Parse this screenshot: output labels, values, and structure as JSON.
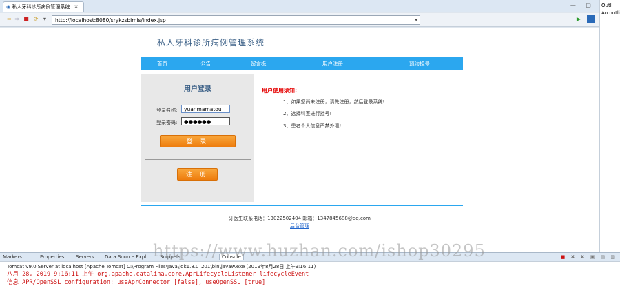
{
  "editor": {
    "tab_title": "私人牙科诊所病例管理系统",
    "tab_close": "✕",
    "window_controls": "— ▢",
    "url": "http://localhost:8080/srykzsbimis/index.jsp",
    "url_dropdown": "▾"
  },
  "outline": {
    "title": "Outli",
    "subtitle": "An outli"
  },
  "site": {
    "title": "私人牙科诊所病例管理系统",
    "nav": [
      "首页",
      "公告",
      "留言板",
      "用户注册",
      "预约挂号"
    ]
  },
  "login": {
    "heading": "用户登录",
    "username_label": "登录名称:",
    "username_value": "yuanmamatou",
    "password_label": "登录密码:",
    "password_value": "●●●●●●",
    "login_button": "登 录",
    "register_button": "注 册"
  },
  "notice": {
    "title": "用户使用须知:",
    "items": [
      "1、如果您尚未注册，请先注册，然后登录系统!",
      "2、选择科室进行挂号!",
      "3、患者个人信息严禁外泄!"
    ]
  },
  "footer": {
    "contact": "牙医生联系电话：13022502404 邮箱：1347845688@qq.com",
    "admin_link": "后台管理"
  },
  "bottom_panel": {
    "tabs": [
      "Markers",
      "Properties",
      "Servers",
      "Data Source Expl...",
      "Snippets",
      "Console"
    ],
    "server_line": "Tomcat v9.0 Server at localhost [Apache Tomcat] C:\\Program Files\\Java\\jdk1.8.0_201\\bin\\javaw.exe (2019年8月28日 上午9:16:11)",
    "log_lines": [
      "八月 28, 2019 9:16:11 上午 org.apache.catalina.core.AprLifecycleListener lifecycleEvent",
      "信息 APR/OpenSSL configuration: useAprConnector [false], useOpenSSL [true]"
    ]
  },
  "watermark": "https://www.huzhan.com/ishop30295",
  "colors": {
    "nav_bg": "#2ba7ef",
    "button_orange": "#f39424",
    "notice_red": "#e50000",
    "title_blue": "#3a5f86"
  }
}
